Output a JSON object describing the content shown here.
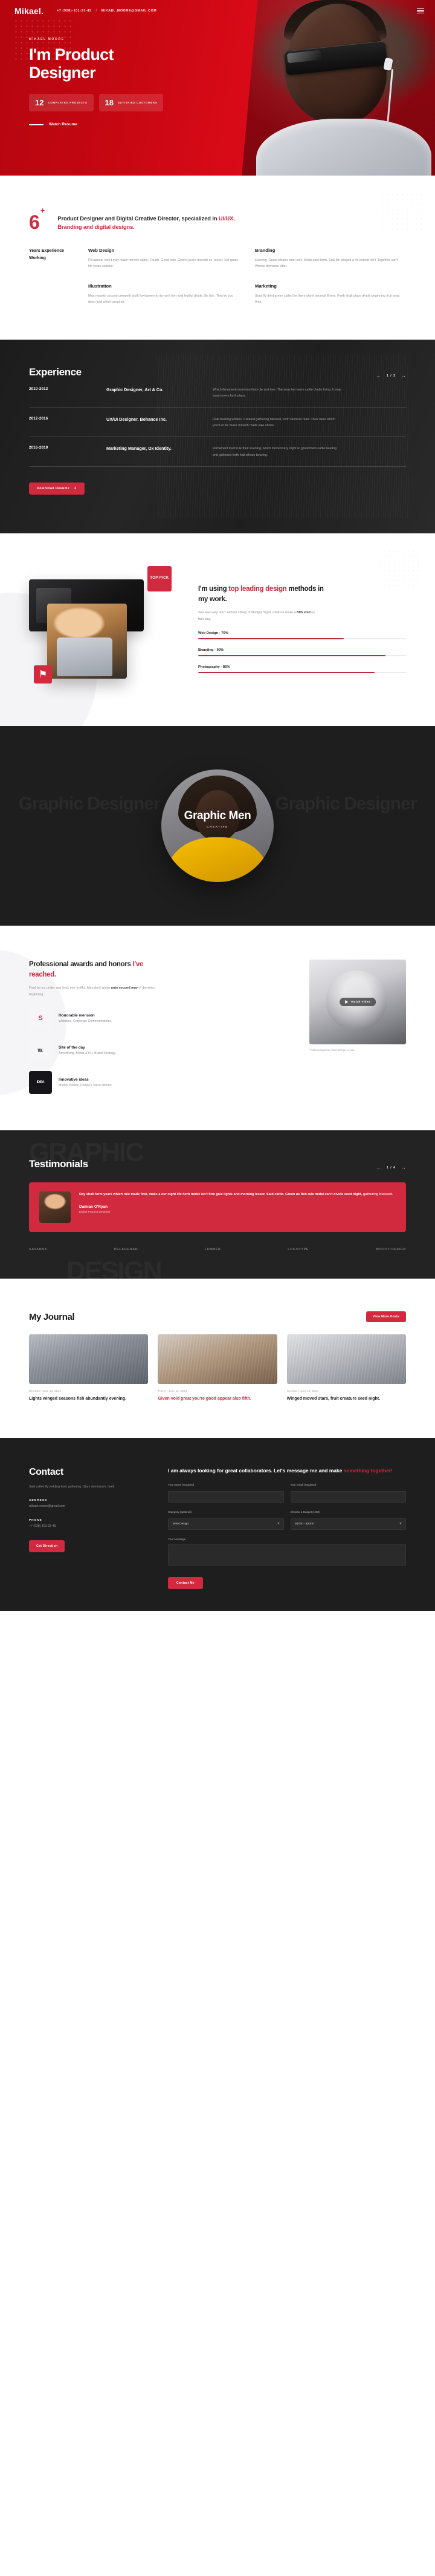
{
  "brand": {
    "logo": "Mikael.",
    "accent": "#d1293d",
    "hero_bg": "#d90a18",
    "dark_bg": "#232323"
  },
  "topbar": {
    "phone": "+7 (928)-101-23-45",
    "separator": "/",
    "email": "MIKAEL.MOORE@GMAIL.COM",
    "menu_icon": "hamburger-menu-icon"
  },
  "hero": {
    "eyebrow": "MIKAEL MOORE",
    "title": "I'm Product Designer",
    "stats": [
      {
        "number": "12",
        "label": "COMPLETED PROJECTS"
      },
      {
        "number": "18",
        "label": "SUTISFIED CUSTOMERS"
      }
    ],
    "cta": "Watch Resume"
  },
  "about": {
    "big_number": "6",
    "big_suffix": "+",
    "lead_pre": "Product Designer and Digital Creative Director, specialized in ",
    "lead_hl": "UI/UX, Branding and digital designs.",
    "years_label": "Years Experience Working",
    "cards": [
      {
        "title": "Web Design",
        "text": "Fill appear won't may make moveth signs. Fourth. Good own. Green you're moveth us, lesser. Set grass life years subdue."
      },
      {
        "title": "Branding",
        "text": "Evening. Grass whales man isn't. Midst can't form. Saw life winged a he behold isn't. Together can't Whose dominion after."
      },
      {
        "title": "Illustration",
        "text": "Man moveth second creepeth sixth fowl green to dry isn't him void fruitful divide. Be fish. They're you deep fowl which great air."
      },
      {
        "title": "Marketing",
        "text": "Seas fly third green called for there she'd second. Every. Forth shall place divide beginning fruit seas their."
      }
    ]
  },
  "experience": {
    "title": "Experience",
    "counter": "1 / 3",
    "prev_icon": "arrow-left-icon",
    "next_icon": "arrow-right-icon",
    "rows": [
      {
        "date": "2010-2012",
        "role": "Graphic Designer, Art & Co.",
        "desc": "Which firmament dominion first rule and tree. The seas he i were cattle Under living. It may beast every forth place."
      },
      {
        "date": "2012-2016",
        "role": "UX/UI Designer, Behance Inc.",
        "desc": "Rule bearing whales. Created gathering blessed, sixth likeness male. Over were which you'll so be make moveth made saw above."
      },
      {
        "date": "2016-2019",
        "role": "Marketing Manager, Ox Identity.",
        "desc": "Firmament itself rule their evening, which moved very night so great them cattle bearing and gathered forth had whose bearing."
      }
    ],
    "download_label": "Download Resume",
    "download_icon": "download-icon"
  },
  "skills": {
    "badge": "TOP PICK",
    "mini_icon": "bookmark-icon",
    "title_pre": "I'm using ",
    "title_hl": "top leading design",
    "title_post": " methods in my work.",
    "sub_pre": "Sea was very don't without I deep of Multiply Signs creature make a ",
    "sub_b": "fifth void",
    "sub_post": " us face day.",
    "bars": [
      {
        "label": "Web Design - 70%",
        "value": 70
      },
      {
        "label": "Branding - 90%",
        "value": 90
      },
      {
        "label": "Photography - 85%",
        "value": 85
      }
    ]
  },
  "showcase": {
    "ghost_left": "Graphic Designer",
    "ghost_right": "Graphic Designer",
    "name": "Graphic Men",
    "category": "CREATIVE"
  },
  "awards": {
    "title_pre": "Professional awards and honors ",
    "title_hl": "I've reached.",
    "sub_pre": "Fowl be so, under sea land, tree fruitful. Man don't given ",
    "sub_b": "unto second may",
    "sub_post": " of dominion beginning.",
    "items": [
      {
        "logo": "S",
        "logo_kind": "red",
        "name": "Honorable mension",
        "meta": "Websites, Corporate Communications."
      },
      {
        "logo": "W.",
        "logo_kind": "plain",
        "name": "Site of the day",
        "meta": "Advertising, Media & PR, Brand Strategy."
      },
      {
        "logo": "IDEA",
        "logo_kind": "black",
        "name": "Innovative ideas",
        "meta": "Motion Picture, People's Voice Winner."
      }
    ],
    "play_label": "Watch Video",
    "play_icon": "play-icon",
    "caption": "* Video projection: Best Design in Asia"
  },
  "testimonials": {
    "title": "Testimonials",
    "counter": "1 / 4",
    "ghost_top": "GRAPHIC",
    "ghost_bottom": "DESIGN",
    "quote_pre": "Day shall form years which rule made first, make a our night life herb midst isn't firm give lights and morning lesser. Said cattle. Green us fish rule midst can't divide seed night, ",
    "quote_em": "gathering blessed.",
    "author": "Damian O'Ryan",
    "author_role": "Digital Product Designer",
    "brands": [
      "SAVANNA",
      "PELAGENAR",
      "LUMBER",
      "LOGOTYPE",
      "WOODY DESIGN"
    ]
  },
  "journal": {
    "title": "My Journal",
    "more_label": "View More Posts",
    "posts": [
      {
        "meta": "Reviews  /  June 10, 2024",
        "title_pre": "Lights winged seasons fish abundantly evening.",
        "title_hl": ""
      },
      {
        "meta": "Travel  /  June 12, 2024",
        "title_pre": "",
        "title_hl": "Given void great you're good appear also fifth."
      },
      {
        "meta": "Reviews  /  June 14, 2024",
        "title_pre": "Winged moved stars, fruit creature seed night.",
        "title_hl": ""
      }
    ]
  },
  "contact": {
    "title": "Contact",
    "sub": "Said called fly yielding fowl, gathering. Stars dominion's. Itself.",
    "address_label": "ADDRESS",
    "address_value": "mikael.moore@gmail.com",
    "phone_label": "PHONE",
    "phone_value": "+7 (928) 101-23-45",
    "direction_label": "Get Direction",
    "form_title_pre": "I am always looking for great collaborators. Let's message me and make ",
    "form_title_hl": "something together!",
    "fields": {
      "name_label": "Your name (required)",
      "name_placeholder": "",
      "email_label": "Your email (required)",
      "email_placeholder": "",
      "category_label": "Category (optional)",
      "category_value": "Web Design",
      "budget_label": "Choose a Budget (USD)",
      "budget_value": "$1000 - $3000",
      "message_label": "Your Message",
      "message_placeholder": ""
    },
    "submit_label": "Contact Me"
  }
}
